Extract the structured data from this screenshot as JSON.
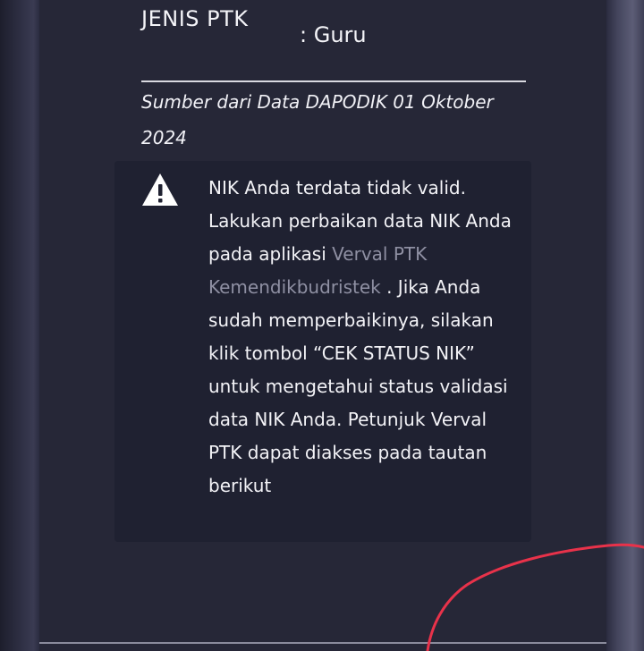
{
  "profile": {
    "field_label": "JENIS PTK",
    "field_value": ": Guru"
  },
  "source_note": "Sumber dari Data DAPODIK 01 Oktober 2024",
  "alert": {
    "icon": "warning-triangle-icon",
    "text_before": "NIK Anda terdata tidak valid. Lakukan perbaikan data NIK Anda pada aplikasi ",
    "link_text": "Verval PTK Kemendikbudristek",
    "text_after": " . Jika Anda sudah memperbaikinya, silakan klik tombol “CEK STATUS NIK” untuk mengetahui status validasi data NIK Anda. Petunjuk Verval PTK dapat diakses pada tautan berikut"
  },
  "colors": {
    "panel_bg": "#262737",
    "alert_bg": "#1f2131",
    "text": "#f3f3f7",
    "link_muted": "#8f90a3",
    "annotation_red": "#e8324a"
  }
}
